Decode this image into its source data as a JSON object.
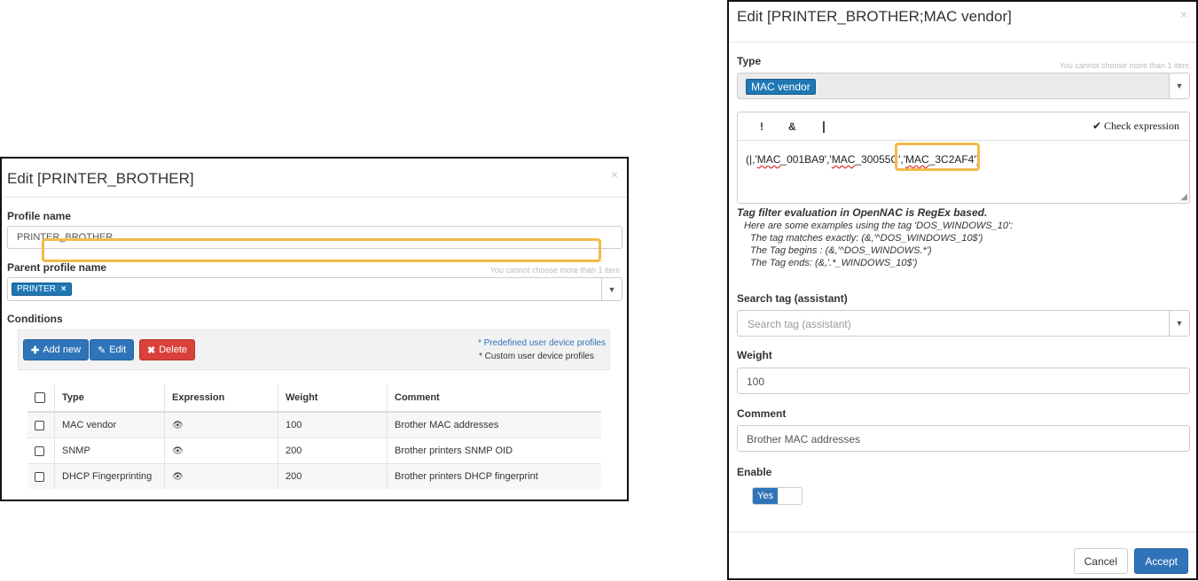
{
  "left_dialog": {
    "title": "Edit [PRINTER_BROTHER]",
    "close_icon": "×",
    "profile_name_label": "Profile name",
    "profile_name_value": "PRINTER_BROTHER",
    "parent_profile_label": "Parent profile name",
    "parent_profile_hint": "You cannot choose more than 1 item",
    "parent_profile_tag": "PRINTER",
    "parent_profile_tag_remove": "×",
    "conditions_label": "Conditions",
    "toolbar": {
      "add_new": "Add new",
      "edit": "Edit",
      "delete": "Delete",
      "legend_predefined": "* Predefined user device profiles",
      "legend_custom": "* Custom user device profiles"
    },
    "table": {
      "headers": [
        "Type",
        "Expression",
        "Weight",
        "Comment"
      ],
      "rows": [
        {
          "type": "MAC vendor",
          "weight": "100",
          "comment": "Brother MAC addresses"
        },
        {
          "type": "SNMP",
          "weight": "200",
          "comment": "Brother printers SNMP OID"
        },
        {
          "type": "DHCP Fingerprinting",
          "weight": "200",
          "comment": "Brother printers DHCP fingerprint"
        }
      ]
    }
  },
  "right_dialog": {
    "title": "Edit [PRINTER_BROTHER;MAC vendor]",
    "close_icon": "×",
    "type_label": "Type",
    "type_hint": "You cannot choose more than 1 item",
    "type_tag": "MAC vendor",
    "operators": {
      "not": "!",
      "and": "&",
      "or": "|"
    },
    "check_expression": "Check expression",
    "expression": {
      "prefix": "(|,'",
      "mac1": "MAC",
      "part1": "_001BA9','",
      "mac2": "MAC",
      "part2": "_30055C',",
      "part3": "'",
      "mac3": "MAC",
      "part4": "_3C2AF4')"
    },
    "help": {
      "title": "Tag filter evaluation in OpenNAC is RegEx based.",
      "line1": "Here are some examples using the tag 'DOS_WINDOWS_10':",
      "line2": "The tag matches exactly: (&,'^DOS_WINDOWS_10$')",
      "line3": "The Tag begins : (&,'^DOS_WINDOWS.*')",
      "line4": "The Tag ends: (&,'.*_WINDOWS_10$')"
    },
    "search_tag_label": "Search tag (assistant)",
    "search_tag_placeholder": "Search tag (assistant)",
    "weight_label": "Weight",
    "weight_value": "100",
    "comment_label": "Comment",
    "comment_value": "Brother MAC addresses",
    "enable_label": "Enable",
    "enable_value": "Yes",
    "cancel": "Cancel",
    "accept": "Accept"
  },
  "colors": {
    "highlight": "#f3ba4a",
    "primary": "#2f74b8",
    "danger": "#d9413a",
    "tag": "#1f78b4"
  }
}
